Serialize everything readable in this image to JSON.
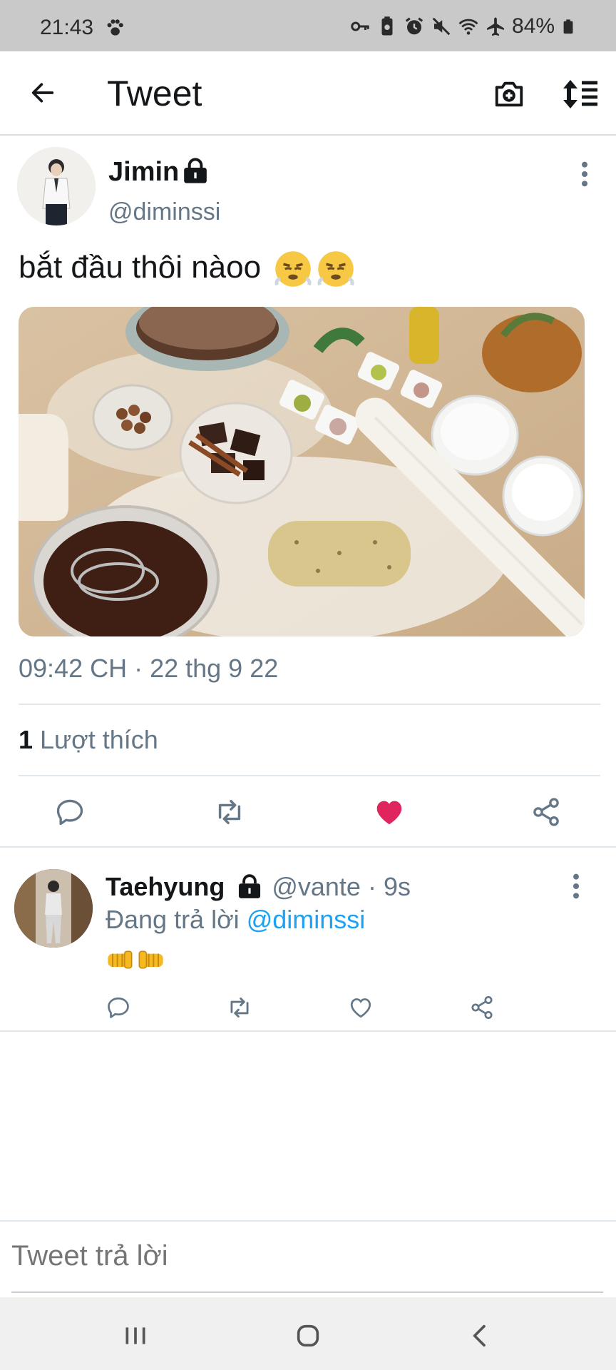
{
  "status_bar": {
    "time": "21:43",
    "battery": "84%"
  },
  "header": {
    "title": "Tweet"
  },
  "tweet": {
    "author_name": "Jimin",
    "author_handle": "@diminssi",
    "text": "bắt đầu thôi nàoo",
    "timestamp": "09:42 CH · 22 thg 9 22",
    "likes_count": "1",
    "likes_label": "Lượt thích",
    "liked": true
  },
  "reply": {
    "author_name": "Taehyung",
    "author_handle": "@vante",
    "time_ago": "· 9s",
    "replying_prefix": "Đang trả lời",
    "replying_to": "@diminssi"
  },
  "compose": {
    "placeholder": "Tweet trả lời"
  },
  "colors": {
    "accent": "#1da1f2",
    "like": "#e0245e",
    "secondary_text": "#657786"
  },
  "icons": [
    "back-arrow-icon",
    "camera-plus-icon",
    "sort-icon",
    "more-vertical-icon",
    "reply-icon",
    "retweet-icon",
    "heart-icon",
    "share-icon"
  ]
}
